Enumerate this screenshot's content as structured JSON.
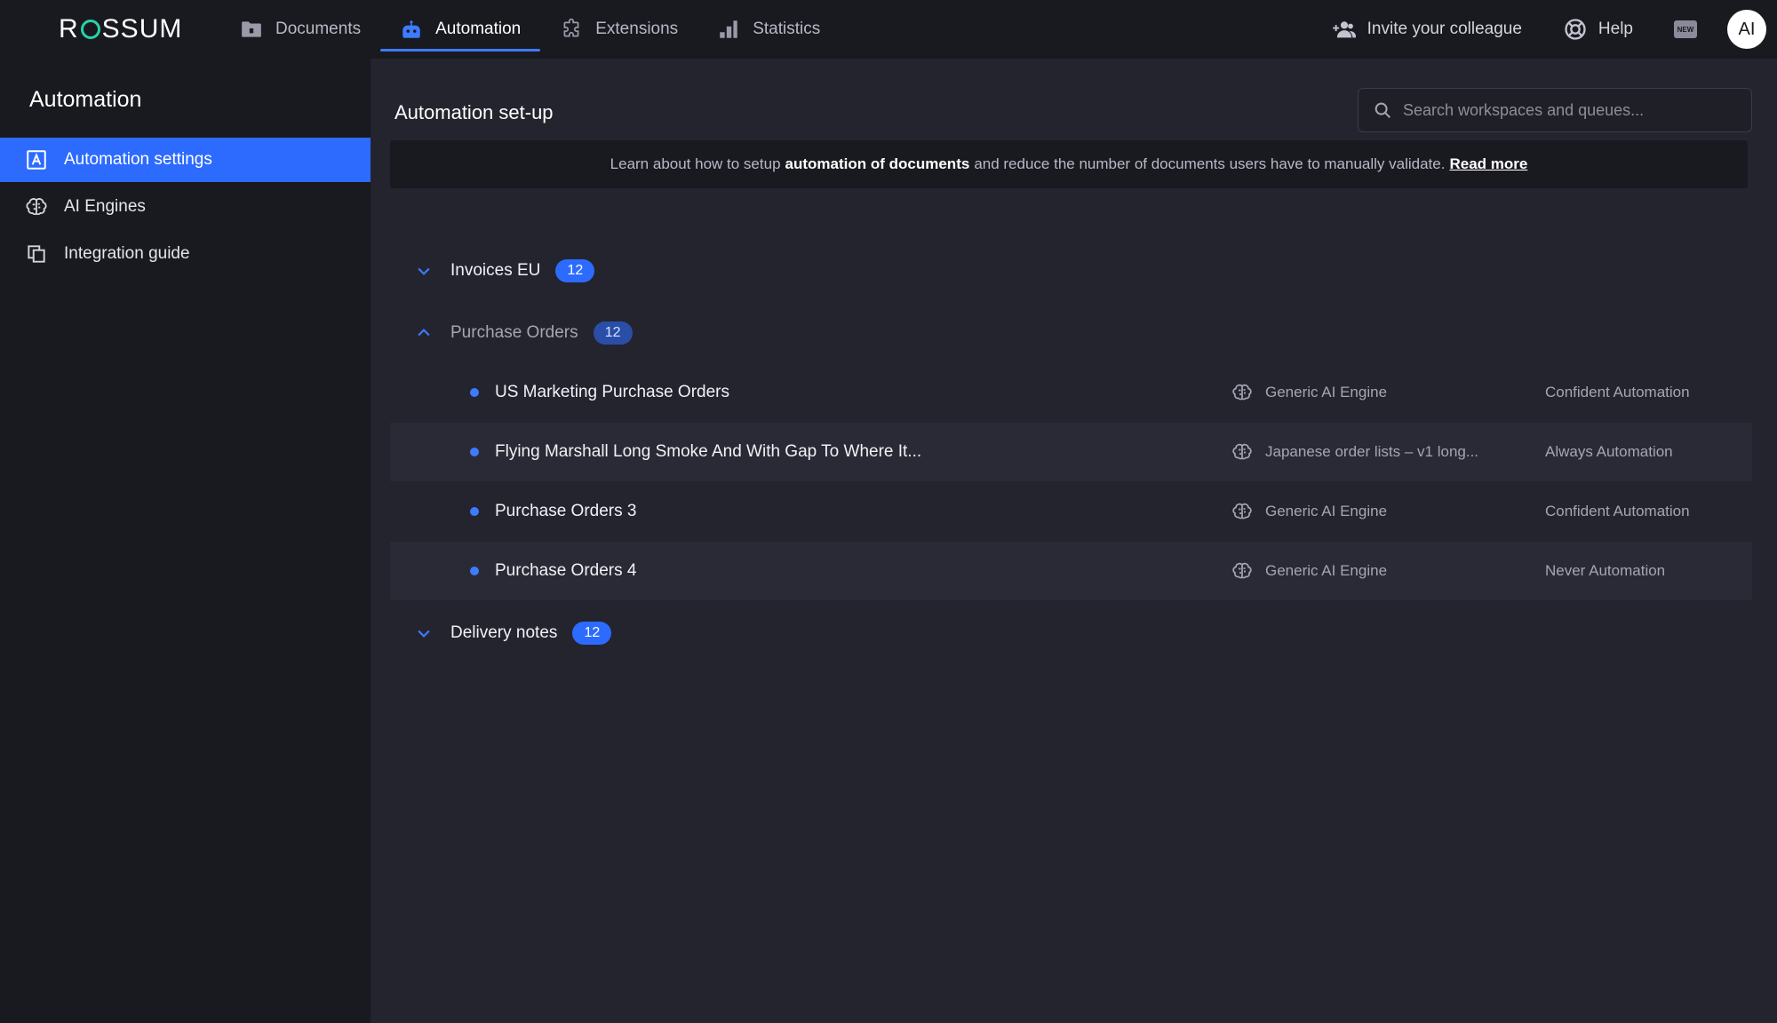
{
  "app": {
    "logo_text_left": "R",
    "logo_text_right": "SSUM",
    "brand_color": "#27d3a8",
    "accent_color": "#2d6bff"
  },
  "nav": {
    "items": [
      {
        "label": "Documents",
        "icon": "folder-icon"
      },
      {
        "label": "Automation",
        "icon": "robot-icon",
        "active": true
      },
      {
        "label": "Extensions",
        "icon": "puzzle-icon"
      },
      {
        "label": "Statistics",
        "icon": "bar-chart-icon"
      }
    ]
  },
  "top_right": {
    "invite_label": "Invite your colleague",
    "help_label": "Help",
    "new_badge": "NEW",
    "avatar_initials": "AI"
  },
  "sidebar": {
    "title": "Automation",
    "items": [
      {
        "label": "Automation settings",
        "icon": "automation-a-icon",
        "active": true
      },
      {
        "label": "AI Engines",
        "icon": "brain-icon"
      },
      {
        "label": "Integration guide",
        "icon": "copy-document-icon"
      }
    ]
  },
  "main": {
    "title": "Automation set-up",
    "search_placeholder": "Search workspaces and queues...",
    "banner": {
      "text_before": "Learn about how to setup",
      "bold": "automation of documents",
      "text_after": "and reduce the number of documents users have to manually validate.",
      "link": "Read more"
    },
    "groups": [
      {
        "name": "Invoices EU",
        "count": "12",
        "expanded": false
      },
      {
        "name": "Purchase Orders",
        "count": "12",
        "expanded": true
      },
      {
        "name": "Delivery notes",
        "count": "12",
        "expanded": false
      }
    ],
    "queues": [
      {
        "name": "US Marketing Purchase Orders",
        "engine": "Generic AI Engine",
        "mode": "Confident Automation"
      },
      {
        "name": "Flying Marshall Long Smoke And With Gap To Where It...",
        "engine": "Japanese order lists – v1 long...",
        "mode": "Always Automation"
      },
      {
        "name": "Purchase Orders 3",
        "engine": "Generic AI Engine",
        "mode": "Confident Automation"
      },
      {
        "name": "Purchase Orders 4",
        "engine": "Generic AI Engine",
        "mode": "Never Automation"
      }
    ]
  }
}
